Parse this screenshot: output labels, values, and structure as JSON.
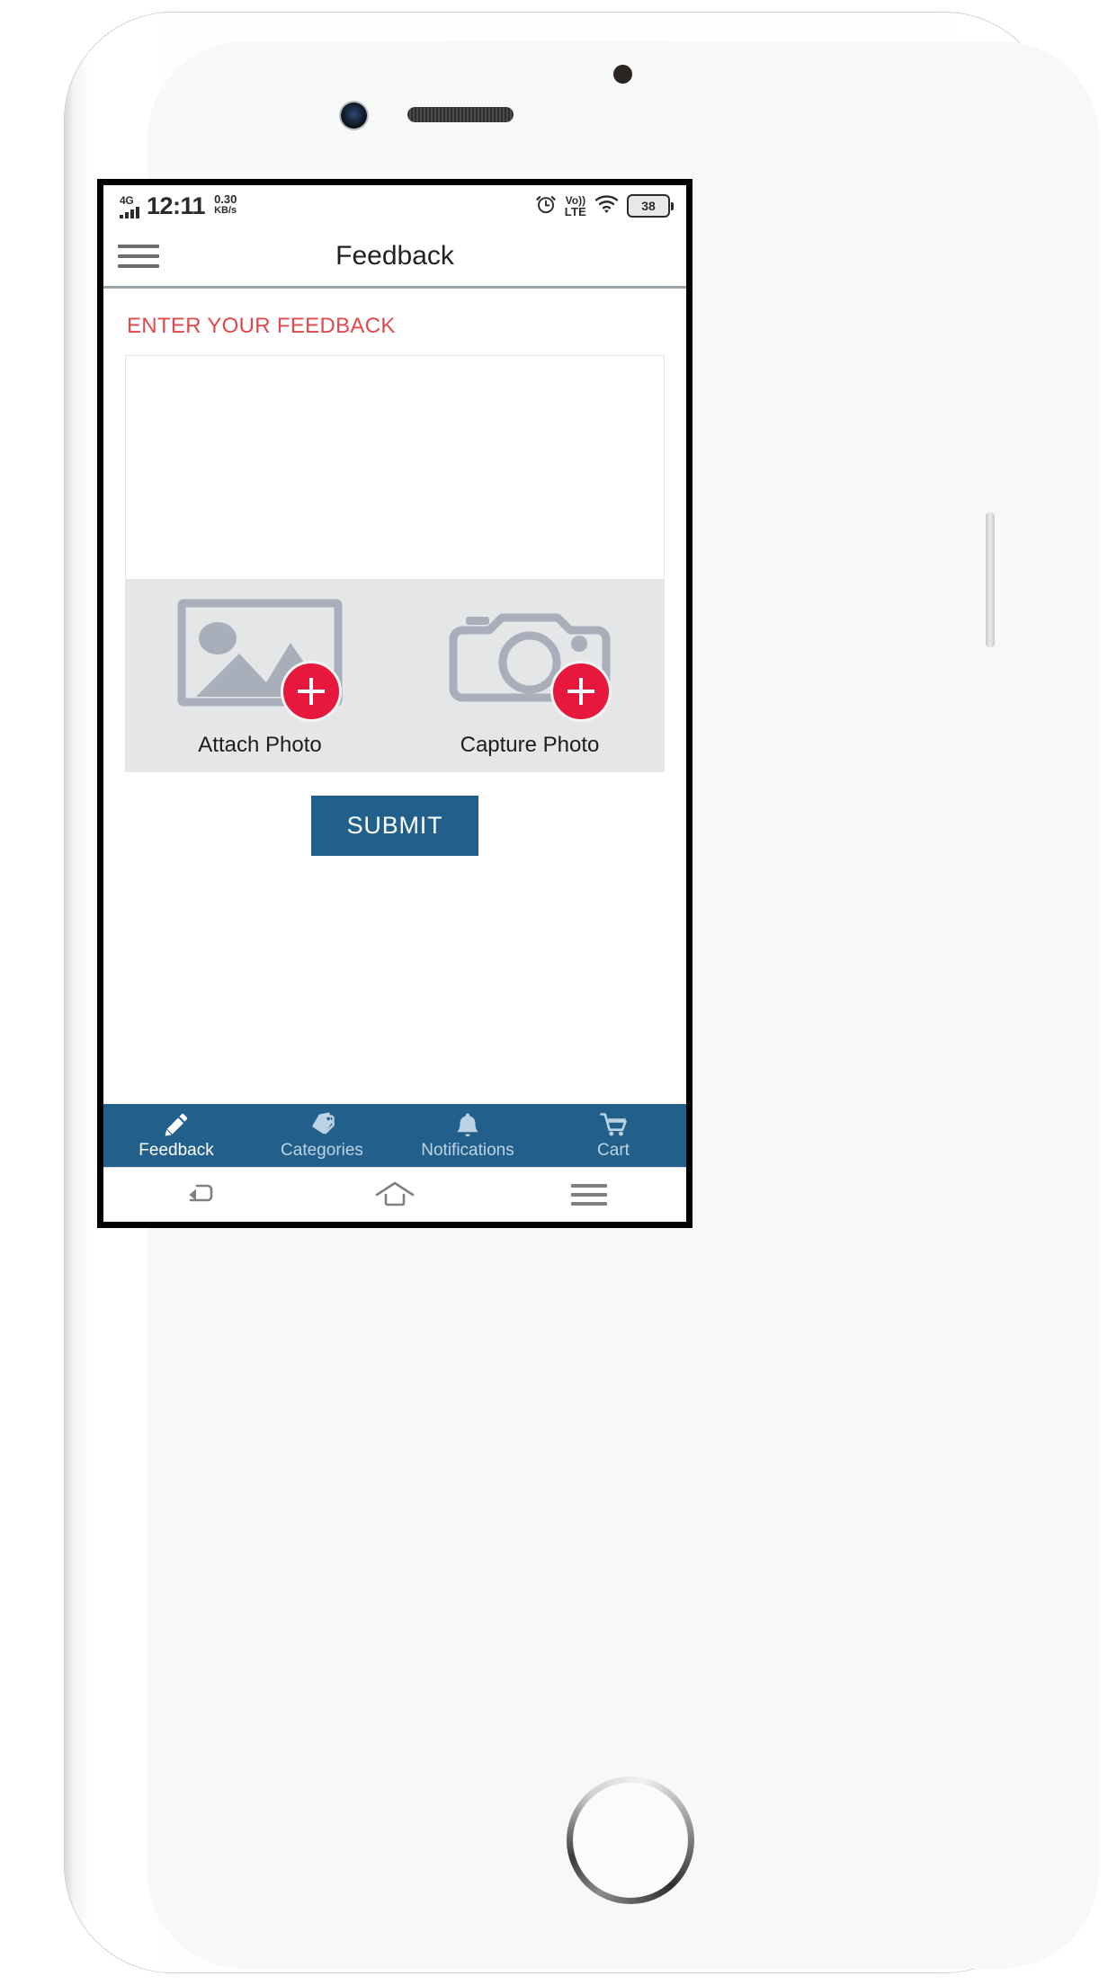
{
  "status_bar": {
    "network_type": "4G",
    "time": "12:11",
    "data_speed_value": "0.30",
    "data_speed_unit": "KB/s",
    "alarm_icon": "alarm-clock-icon",
    "volte_top": "Vo))",
    "volte_bottom": "LTE",
    "wifi_icon": "wifi-icon",
    "battery_level": "38"
  },
  "app_bar": {
    "menu_icon": "hamburger-menu-icon",
    "title": "Feedback"
  },
  "main": {
    "section_heading": "ENTER YOUR FEEDBACK",
    "feedback_value": "",
    "feedback_placeholder": "",
    "photo_options": [
      {
        "label": "Attach Photo",
        "icon": "image-placeholder-icon",
        "badge": "plus-icon"
      },
      {
        "label": "Capture Photo",
        "icon": "camera-icon",
        "badge": "plus-icon"
      }
    ],
    "submit_label": "SUBMIT"
  },
  "tab_bar": {
    "items": [
      {
        "label": "Feedback",
        "icon": "pencil-icon",
        "active": true
      },
      {
        "label": "Categories",
        "icon": "tags-icon",
        "active": false
      },
      {
        "label": "Notifications",
        "icon": "bell-icon",
        "active": false
      },
      {
        "label": "Cart",
        "icon": "shopping-cart-icon",
        "active": false
      }
    ]
  },
  "nav_bar": {
    "back_icon": "back-arrow-icon",
    "home_icon": "home-outline-icon",
    "recent_icon": "recent-apps-icon"
  },
  "colors": {
    "accent_red": "#e0484c",
    "badge_red": "#e8173d",
    "primary_blue": "#21608b",
    "panel_gray": "#e5e6e7",
    "icon_gray": "#a8aeba"
  }
}
